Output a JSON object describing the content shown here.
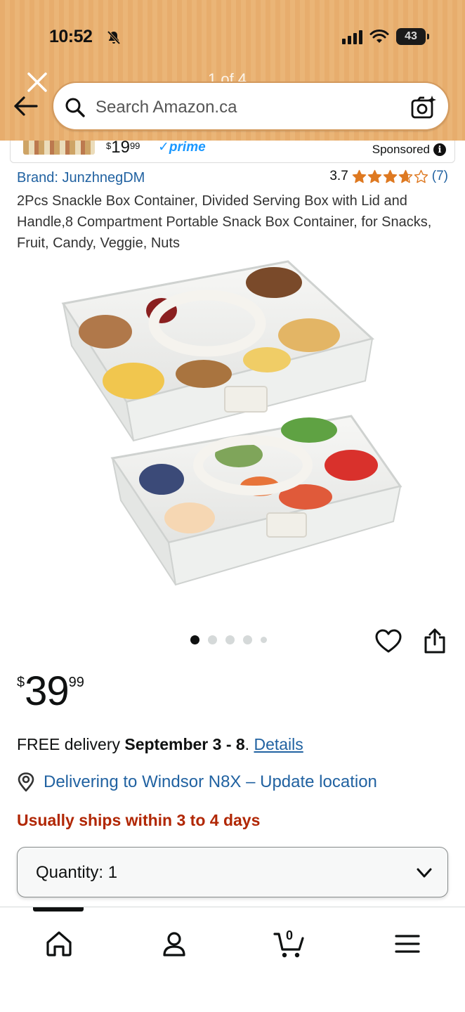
{
  "status_bar": {
    "time": "10:52",
    "battery": "43"
  },
  "header": {
    "image_pager": "1 of 4",
    "search": {
      "placeholder": "Search Amazon.ca"
    }
  },
  "sponsored_strip": {
    "price_whole": "19",
    "price_fraction": "99",
    "currency": "$",
    "prime_label": "prime",
    "sponsored_label": "Sponsored",
    "info_glyph": "i"
  },
  "product": {
    "brand": "Brand: JunzhnegDM",
    "rating": "3.7",
    "stars_value": 3.7,
    "stars_max": 5,
    "rating_count": "(7)",
    "title": "2Pcs Snackle Box Container, Divided Serving Box with Lid and Handle,8 Compartment Portable Snack Box Container, for Snacks, Fruit, Candy, Veggie, Nuts",
    "image_count": 5,
    "active_image_index": 0
  },
  "price": {
    "symbol": "$",
    "whole": "39",
    "fraction": "99"
  },
  "delivery": {
    "prefix": "FREE delivery ",
    "dates": "September 3 - 8",
    "suffix": ". ",
    "details_link": "Details"
  },
  "location": {
    "text": "Delivering to Windsor N8X – Update location"
  },
  "shipping_note": "Usually ships within 3 to 4 days",
  "quantity": {
    "label": "Quantity:",
    "value": "1"
  },
  "bottom_nav": {
    "items": [
      "home",
      "you",
      "cart",
      "menu"
    ],
    "cart_count": "0",
    "active": "home"
  },
  "colors": {
    "header_bg": "#e7ad6d",
    "link": "#2162a1",
    "star": "#de7921",
    "shipping_note": "#b12704",
    "prime": "#1a98ff"
  }
}
